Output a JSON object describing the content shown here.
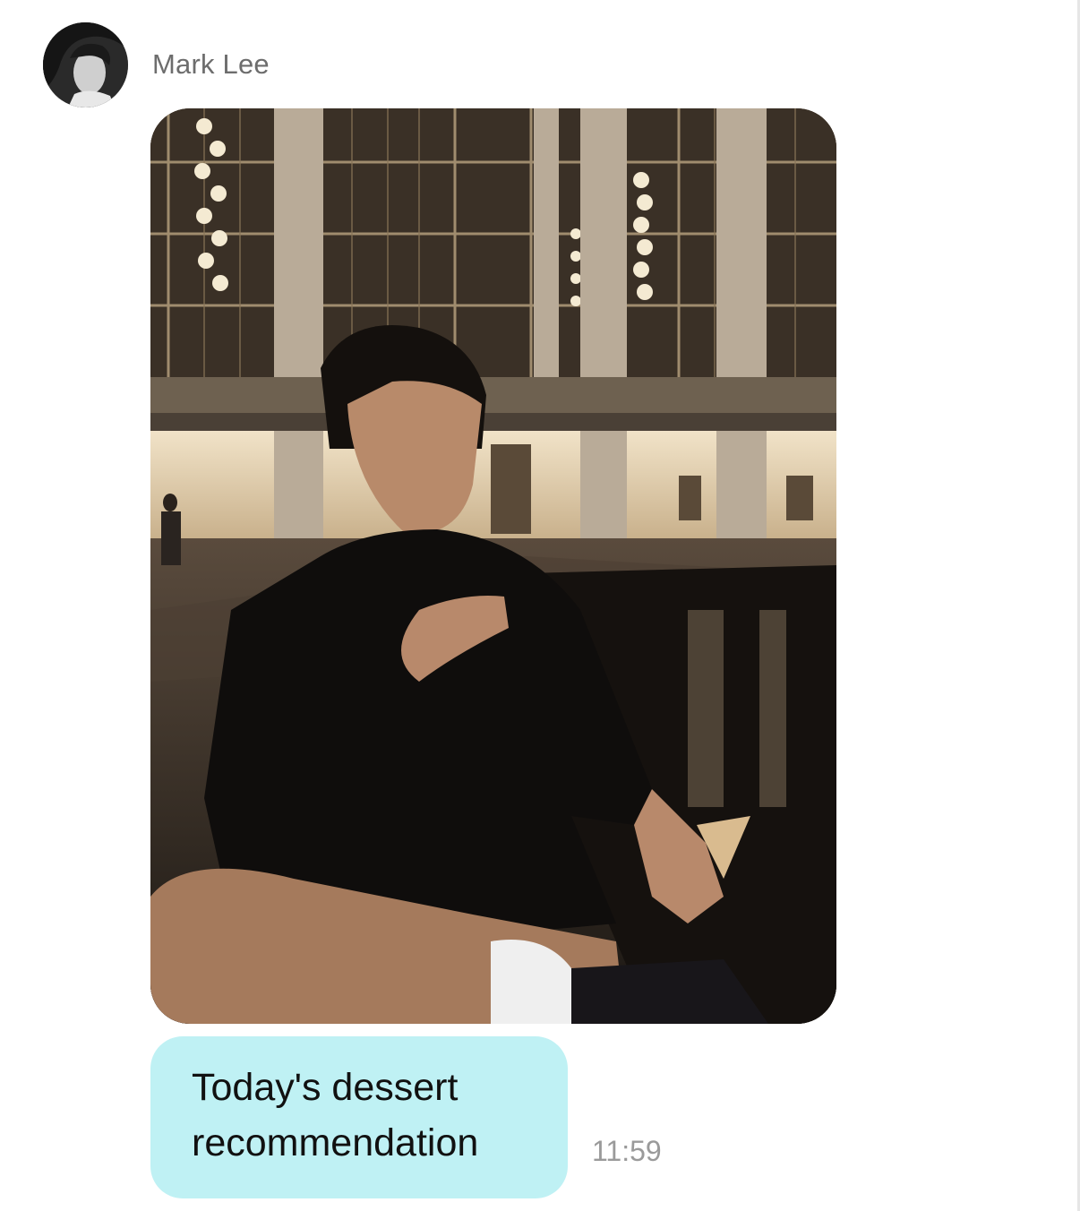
{
  "sender": {
    "name": "Mark Lee"
  },
  "message": {
    "lines": [
      "Today's dessert",
      "recommendation"
    ],
    "time": "11:59"
  },
  "icons": {
    "avatar": "profile-avatar-icon"
  },
  "colors": {
    "bubble": "#bff1f4",
    "name_text": "#6d6d6d",
    "time_text": "#9a9a9a",
    "message_text": "#111111"
  }
}
